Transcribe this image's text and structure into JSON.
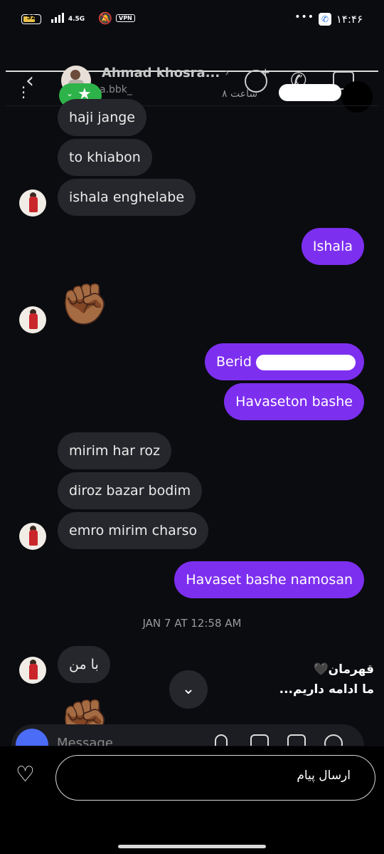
{
  "status_bar": {
    "battery": "52",
    "network": "4.5G",
    "vpn": "VPN",
    "clock": "۱۴:۴۶",
    "overflow": "•••",
    "icons": [
      "battery-icon",
      "signal-icon",
      "bell-muted-icon",
      "vpn-icon",
      "phone-badge-icon"
    ]
  },
  "header": {
    "back_icon": "chevron-left-icon",
    "contact_name": "Ahmad khosra...",
    "handle": "a.bbk_",
    "last_seen": "۸ ساعت",
    "icons": [
      "add-emoji-icon",
      "phone-icon",
      "video-icon",
      "star-icon",
      "more-icon"
    ]
  },
  "messages": [
    {
      "side": "in",
      "text": "haji jange"
    },
    {
      "side": "in",
      "text": "to khiabon"
    },
    {
      "side": "in",
      "text": "ishala enghelabe"
    },
    {
      "side": "out",
      "text": "Ishala"
    },
    {
      "side": "in",
      "emoji": "✊🏾"
    },
    {
      "side": "out",
      "text": "Berid"
    },
    {
      "side": "out",
      "text": "Havaseton bashe"
    },
    {
      "side": "in",
      "text": "mirim har roz"
    },
    {
      "side": "in",
      "text": "diroz bazar bodim"
    },
    {
      "side": "in",
      "text": "emro mirim charso"
    },
    {
      "side": "out",
      "text": "Havaset bashe namosan"
    },
    {
      "side": "in",
      "text": "با من"
    },
    {
      "side": "in",
      "emoji": "✊🏾"
    }
  ],
  "date_separator": "JAN 7 AT 12:58 AM",
  "caption": {
    "line1": "قهرمان🖤",
    "line2": "ما ادامه داریم..."
  },
  "composer": {
    "placeholder": "Message",
    "icons": [
      "camera-icon",
      "mic-icon",
      "gallery-icon",
      "sticker-icon",
      "plus-icon"
    ]
  },
  "reply_bar": {
    "placeholder": "ارسال پیام",
    "like_icon": "heart-icon"
  }
}
